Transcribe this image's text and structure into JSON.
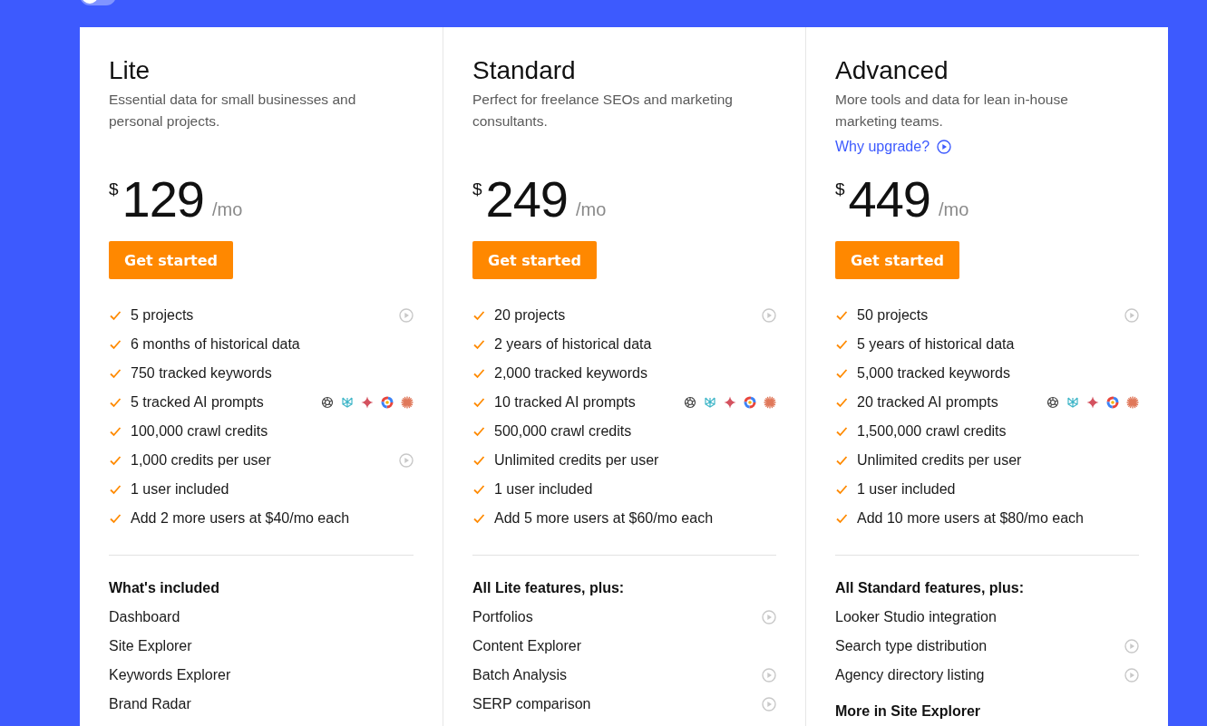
{
  "billing_toggle": {
    "on": false
  },
  "plans": [
    {
      "name": "Lite",
      "description": "Essential data for small businesses and personal projects.",
      "price": {
        "currency": "$",
        "amount": "129",
        "period": "/mo"
      },
      "button": "Get started",
      "features": [
        {
          "text": "5 projects",
          "kind": "video"
        },
        {
          "text": "6 months of historical data",
          "kind": "plain"
        },
        {
          "text": "750 tracked keywords",
          "kind": "plain"
        },
        {
          "text": "5 tracked AI prompts",
          "kind": "ai"
        },
        {
          "text": "100,000 crawl credits",
          "kind": "plain"
        },
        {
          "text": "1,000 credits per user",
          "kind": "video"
        },
        {
          "text": "1 user included",
          "kind": "plain"
        },
        {
          "text": "Add 2 more users at $40/mo each",
          "kind": "plain"
        }
      ],
      "sections": [
        {
          "heading": "What's included",
          "items": [
            {
              "text": "Dashboard",
              "kind": "plain"
            },
            {
              "text": "Site Explorer",
              "kind": "plain"
            },
            {
              "text": "Keywords Explorer",
              "kind": "plain"
            },
            {
              "text": "Brand Radar",
              "kind": "plain"
            }
          ]
        }
      ]
    },
    {
      "name": "Standard",
      "description": "Perfect for freelance SEOs and marketing consultants.",
      "price": {
        "currency": "$",
        "amount": "249",
        "period": "/mo"
      },
      "button": "Get started",
      "features": [
        {
          "text": "20 projects",
          "kind": "video"
        },
        {
          "text": "2 years of historical data",
          "kind": "plain"
        },
        {
          "text": "2,000 tracked keywords",
          "kind": "plain"
        },
        {
          "text": "10 tracked AI prompts",
          "kind": "ai"
        },
        {
          "text": "500,000 crawl credits",
          "kind": "plain"
        },
        {
          "text": "Unlimited credits per user",
          "kind": "plain"
        },
        {
          "text": "1 user included",
          "kind": "plain"
        },
        {
          "text": "Add 5 more users at $60/mo each",
          "kind": "plain"
        }
      ],
      "sections": [
        {
          "heading": "All Lite features, plus:",
          "items": [
            {
              "text": "Portfolios",
              "kind": "video"
            },
            {
              "text": "Content Explorer",
              "kind": "plain"
            },
            {
              "text": "Batch Analysis",
              "kind": "video"
            },
            {
              "text": "SERP comparison",
              "kind": "video"
            }
          ]
        }
      ]
    },
    {
      "name": "Advanced",
      "description": "More tools and data for lean in-house marketing teams.",
      "link": "Why upgrade?",
      "price": {
        "currency": "$",
        "amount": "449",
        "period": "/mo"
      },
      "button": "Get started",
      "features": [
        {
          "text": "50 projects",
          "kind": "video"
        },
        {
          "text": "5 years of historical data",
          "kind": "plain"
        },
        {
          "text": "5,000 tracked keywords",
          "kind": "plain"
        },
        {
          "text": "20 tracked AI prompts",
          "kind": "ai"
        },
        {
          "text": "1,500,000 crawl credits",
          "kind": "plain"
        },
        {
          "text": "Unlimited credits per user",
          "kind": "plain"
        },
        {
          "text": "1 user included",
          "kind": "plain"
        },
        {
          "text": "Add 10 more users at $80/mo each",
          "kind": "plain"
        }
      ],
      "sections": [
        {
          "heading": "All Standard features, plus:",
          "items": [
            {
              "text": "Looker Studio integration",
              "kind": "plain"
            },
            {
              "text": "Search type distribution",
              "kind": "video"
            },
            {
              "text": "Agency directory listing",
              "kind": "video"
            }
          ]
        },
        {
          "heading": "More in Site Explorer"
        }
      ]
    }
  ]
}
